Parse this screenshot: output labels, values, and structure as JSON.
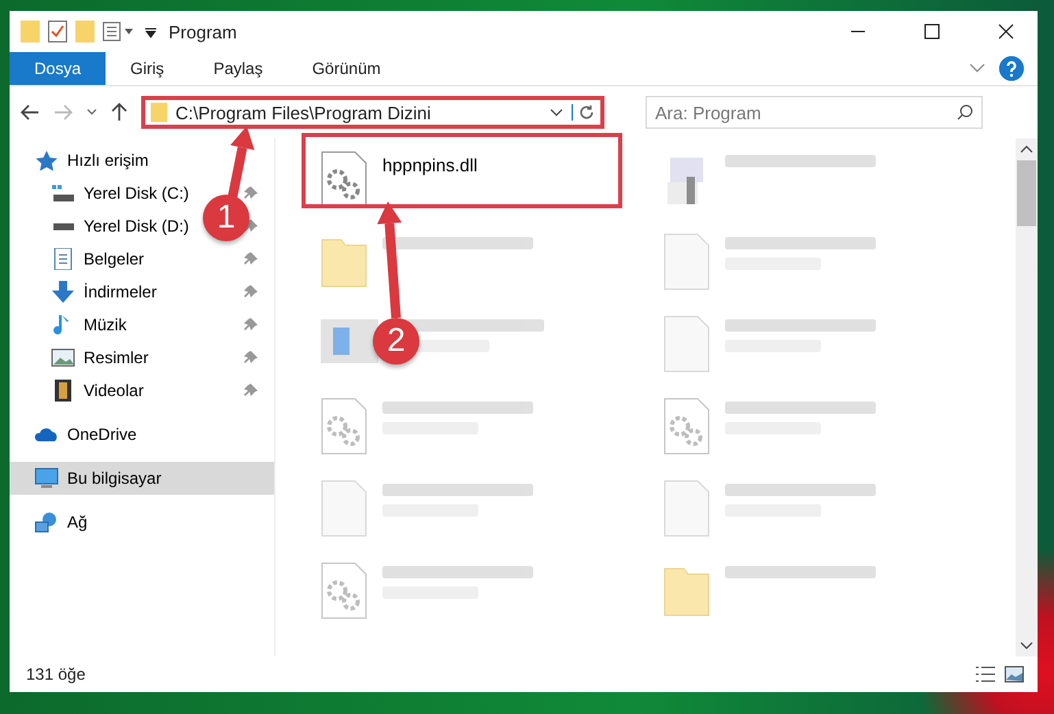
{
  "window": {
    "title": "Program"
  },
  "ribbon": {
    "tabs": [
      {
        "label": "Dosya",
        "selected": true
      },
      {
        "label": "Giriş",
        "selected": false
      },
      {
        "label": "Paylaş",
        "selected": false
      },
      {
        "label": "Görünüm",
        "selected": false
      }
    ]
  },
  "address_bar": {
    "path": "C:\\Program Files\\Program Dizini"
  },
  "search": {
    "placeholder": "Ara: Program"
  },
  "sidebar": {
    "items": [
      {
        "label": "Hızlı erişim",
        "kind": "star",
        "selected": false,
        "children": [
          {
            "label": "Yerel Disk (C:)",
            "kind": "drive-c",
            "pinned": true,
            "selected": false
          },
          {
            "label": "Yerel Disk (D:)",
            "kind": "drive",
            "pinned": true,
            "selected": false
          },
          {
            "label": "Belgeler",
            "kind": "documents",
            "pinned": true,
            "selected": false
          },
          {
            "label": "İndirmeler",
            "kind": "downloads",
            "pinned": true,
            "selected": false
          },
          {
            "label": "Müzik",
            "kind": "music",
            "pinned": true,
            "selected": false
          },
          {
            "label": "Resimler",
            "kind": "pictures",
            "pinned": true,
            "selected": false
          },
          {
            "label": "Videolar",
            "kind": "videos",
            "pinned": true,
            "selected": false
          }
        ]
      },
      {
        "label": "OneDrive",
        "kind": "cloud",
        "selected": false
      },
      {
        "label": "Bu bilgisayar",
        "kind": "computer",
        "selected": true
      },
      {
        "label": "Ağ",
        "kind": "network",
        "selected": false
      }
    ]
  },
  "files": [
    {
      "name": "hppnpins.dll",
      "kind": "dll"
    }
  ],
  "blurred_files": [
    {
      "kind": "exe",
      "subtitle": false
    },
    {
      "kind": "folder",
      "subtitle": false
    },
    {
      "kind": "file",
      "subtitle": true
    },
    {
      "kind": "installer",
      "subtitle": true
    },
    {
      "kind": "file",
      "subtitle": true
    },
    {
      "kind": "dll",
      "subtitle": true
    },
    {
      "kind": "dll",
      "subtitle": true
    },
    {
      "kind": "file",
      "subtitle": true
    },
    {
      "kind": "file",
      "subtitle": true
    },
    {
      "kind": "dll",
      "subtitle": true
    },
    {
      "kind": "folder",
      "subtitle": false
    }
  ],
  "status_bar": {
    "count": "131 öğe"
  },
  "annotations": [
    {
      "number": "1"
    },
    {
      "number": "2"
    }
  ]
}
